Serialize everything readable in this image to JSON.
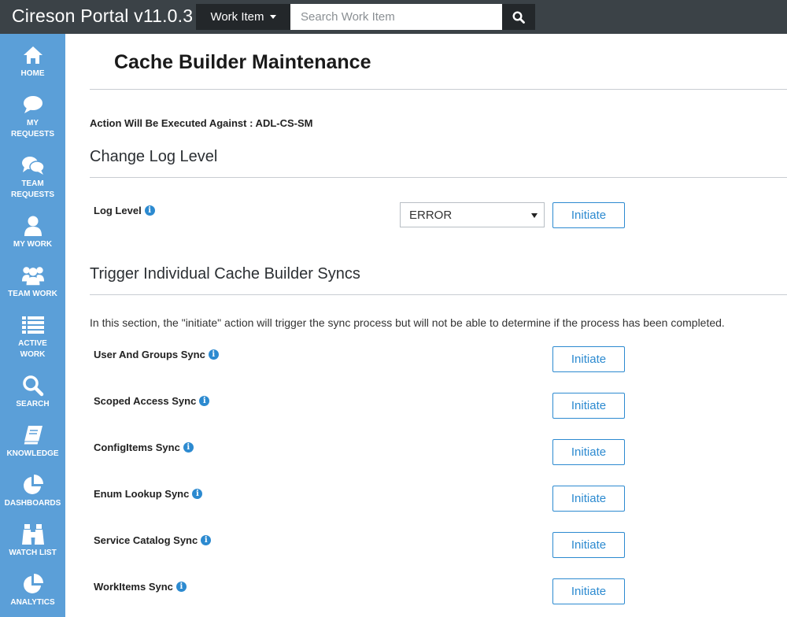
{
  "header": {
    "brand": "Cireson Portal v11.0.3",
    "work_item_label": "Work Item",
    "search_placeholder": "Search Work Item"
  },
  "sidebar": {
    "items": [
      {
        "label": "HOME",
        "icon": "home-icon"
      },
      {
        "label": "MY\nREQUESTS",
        "icon": "chat-bubble-icon"
      },
      {
        "label": "TEAM\nREQUESTS",
        "icon": "chat-bubbles-icon"
      },
      {
        "label": "MY WORK",
        "icon": "user-icon"
      },
      {
        "label": "TEAM WORK",
        "icon": "users-icon"
      },
      {
        "label": "ACTIVE\nWORK",
        "icon": "list-icon"
      },
      {
        "label": "SEARCH",
        "icon": "search-icon"
      },
      {
        "label": "KNOWLEDGE",
        "icon": "book-icon"
      },
      {
        "label": "DASHBOARDS",
        "icon": "pie-chart-icon"
      },
      {
        "label": "WATCH LIST",
        "icon": "binoculars-icon"
      },
      {
        "label": "ANALYTICS",
        "icon": "pie-chart-icon"
      }
    ]
  },
  "page": {
    "title": "Cache Builder Maintenance",
    "target_text": "Action Will Be Executed Against : ADL-CS-SM",
    "log_section_title": "Change Log Level",
    "log_level_label": "Log Level",
    "log_level_value": "ERROR",
    "sync_section_title": "Trigger Individual Cache Builder Syncs",
    "sync_description": "In this section, the \"initiate\" action will trigger the sync process but will not be able to determine if the process has been completed.",
    "initiate_label": "Initiate",
    "syncs": [
      "User And Groups Sync",
      "Scoped Access Sync",
      "ConfigItems Sync",
      "Enum Lookup Sync",
      "Service Catalog Sync",
      "WorkItems Sync"
    ]
  },
  "colors": {
    "topbar": "#3b4247",
    "sidebar": "#5b9fd8",
    "accent": "#2c8ad0"
  }
}
